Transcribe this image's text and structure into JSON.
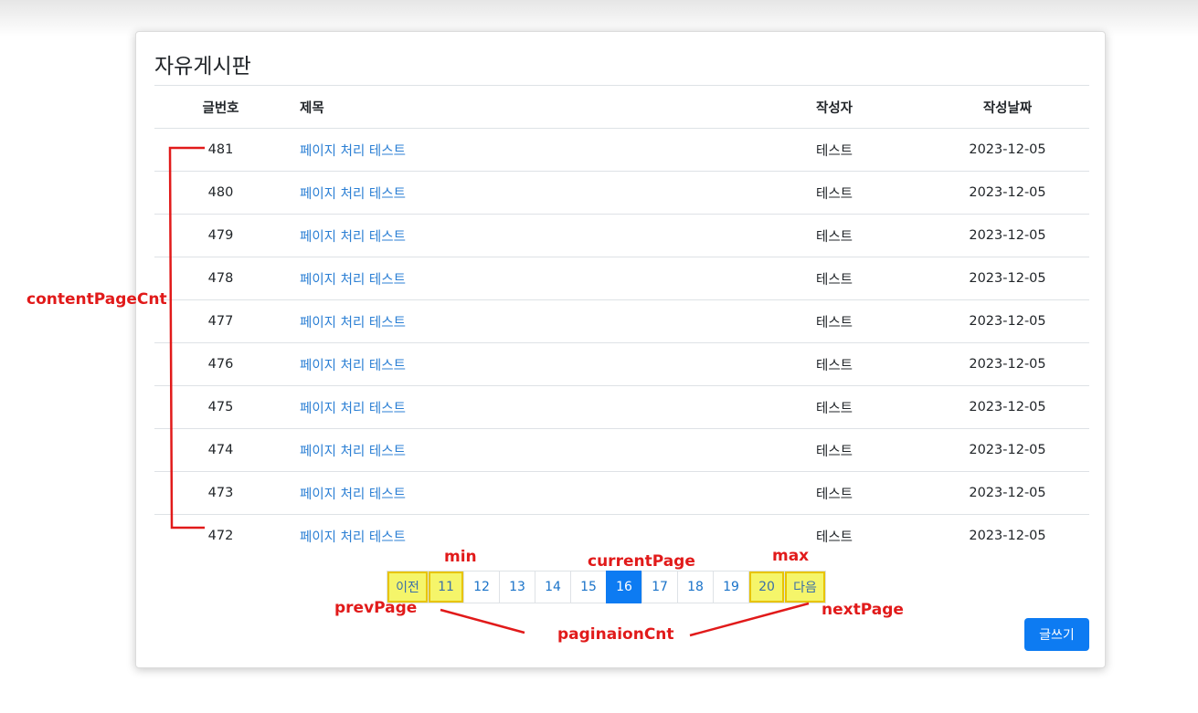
{
  "board": {
    "title": "자유게시판",
    "columns": {
      "no": "글번호",
      "title": "제목",
      "writer": "작성자",
      "date": "작성날짜"
    },
    "rows": [
      {
        "no": "481",
        "title": "페이지 처리 테스트",
        "writer": "테스트",
        "date": "2023-12-05"
      },
      {
        "no": "480",
        "title": "페이지 처리 테스트",
        "writer": "테스트",
        "date": "2023-12-05"
      },
      {
        "no": "479",
        "title": "페이지 처리 테스트",
        "writer": "테스트",
        "date": "2023-12-05"
      },
      {
        "no": "478",
        "title": "페이지 처리 테스트",
        "writer": "테스트",
        "date": "2023-12-05"
      },
      {
        "no": "477",
        "title": "페이지 처리 테스트",
        "writer": "테스트",
        "date": "2023-12-05"
      },
      {
        "no": "476",
        "title": "페이지 처리 테스트",
        "writer": "테스트",
        "date": "2023-12-05"
      },
      {
        "no": "475",
        "title": "페이지 처리 테스트",
        "writer": "테스트",
        "date": "2023-12-05"
      },
      {
        "no": "474",
        "title": "페이지 처리 테스트",
        "writer": "테스트",
        "date": "2023-12-05"
      },
      {
        "no": "473",
        "title": "페이지 처리 테스트",
        "writer": "테스트",
        "date": "2023-12-05"
      },
      {
        "no": "472",
        "title": "페이지 처리 테스트",
        "writer": "테스트",
        "date": "2023-12-05"
      }
    ]
  },
  "pagination": {
    "prev": "이전",
    "pages": [
      "11",
      "12",
      "13",
      "14",
      "15",
      "16",
      "17",
      "18",
      "19",
      "20"
    ],
    "current": "16",
    "next": "다음"
  },
  "write_button": "글쓰기",
  "annotations": {
    "content_page_cnt": "contentPageCnt",
    "min": "min",
    "current_page": "currentPage",
    "max": "max",
    "prev_page": "prevPage",
    "next_page": "nextPage",
    "pagination_cnt": "paginaionCnt",
    "color": "#e11a1a",
    "highlight_color": "#f5f56a"
  }
}
